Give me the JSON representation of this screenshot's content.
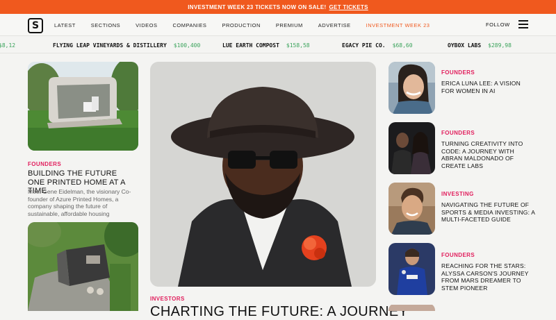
{
  "promo": {
    "text": "INVESTMENT WEEK 23 TICKETS NOW ON SALE!",
    "link": "GET TICKETS"
  },
  "nav": {
    "logo": "S",
    "items": [
      "LATEST",
      "SECTIONS",
      "VIDEOS",
      "COMPANIES",
      "PRODUCTION",
      "PREMIUM",
      "ADVERTISE",
      "INVESTMENT WEEK 23"
    ],
    "follow": "FOLLOW"
  },
  "ticker": [
    {
      "name": "",
      "value": "$8,12"
    },
    {
      "name": "FLYING LEAP VINEYARDS & DISTILLERY",
      "value": "$100,400"
    },
    {
      "name": "LUE EARTH COMPOST",
      "value": "$158,58"
    },
    {
      "name": "EGACY PIE CO.",
      "value": "$68,60"
    },
    {
      "name": "OYBOX LABS",
      "value": "$289,98"
    }
  ],
  "left": {
    "card1": {
      "label": "FOUNDERS",
      "headline": "BUILDING THE FUTURE ONE PRINTED HOME AT A TIME",
      "body": "Meet Gene Eidelman, the visionary Co-founder of Azure Printed Homes, a company shaping the future of sustainable, affordable housing"
    }
  },
  "hero": {
    "label": "INVESTORS",
    "title": "CHARTING THE FUTURE: A JOURNEY"
  },
  "side": [
    {
      "label": "FOUNDERS",
      "headline": "ERICA LUNA LEE: A VISION FOR WOMEN IN AI"
    },
    {
      "label": "FOUNDERS",
      "headline": "TURNING CREATIVITY INTO CODE: A JOURNEY WITH ABRAN MALDONADO OF CREATE LABS"
    },
    {
      "label": "INVESTING",
      "headline": "NAVIGATING THE FUTURE OF SPORTS & MEDIA INVESTING: A MULTI-FACETED GUIDE"
    },
    {
      "label": "FOUNDERS",
      "headline": "REACHING FOR THE STARS: ALYSSA CARSON'S JOURNEY FROM MARS DREAMER TO STEM PIONEER"
    }
  ]
}
